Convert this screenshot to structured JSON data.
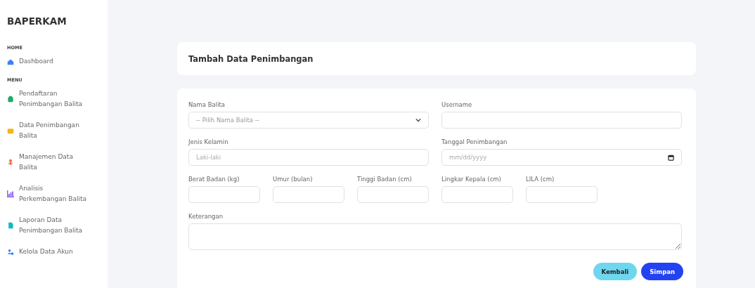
{
  "sidebar": {
    "brand": "BAPERKAM",
    "sections": [
      {
        "heading": "HOME",
        "items": [
          {
            "label": "Dashboard",
            "color": "#3b82f6"
          }
        ]
      },
      {
        "heading": "MENU",
        "items": [
          {
            "label": "Pendaftaran Penimbangan Balita",
            "color": "#22a861"
          },
          {
            "label": "Data Penimbangan Balita",
            "color": "#f2b619"
          },
          {
            "label": "Manajemen Data Balita",
            "color": "#f0734f"
          },
          {
            "label": "Analisis Perkembangan Balita",
            "color": "#8b5cf6"
          },
          {
            "label": "Laporan Data Penimbangan Balita",
            "color": "#14b8c6"
          },
          {
            "label": "Kelola Data Akun",
            "color": "#3b82f6"
          }
        ]
      }
    ]
  },
  "header": {
    "title": "Tambah Data Penimbangan"
  },
  "form": {
    "rows": [
      {
        "fields": [
          {
            "label": "Nama Balita",
            "kind": "select",
            "value": "-- Pilih Nama Balita --"
          },
          {
            "label": "Username",
            "kind": "text"
          }
        ]
      },
      {
        "fields": [
          {
            "label": "Jenis Kelamin",
            "kind": "text",
            "placeholder": "Laki-laki"
          },
          {
            "label": "Tanggal Penimbangan",
            "kind": "date",
            "placeholder": "mm/dd/yyyy"
          }
        ]
      },
      {
        "fields": [
          {
            "label": "Berat Badan (kg)",
            "kind": "text"
          },
          {
            "label": "Umur (bulan)",
            "kind": "text"
          },
          {
            "label": "Tinggi Badan (cm)",
            "kind": "text"
          },
          {
            "label": "Lingkar Kepala (cm)",
            "kind": "text"
          },
          {
            "label": "LILA (cm)",
            "kind": "text"
          }
        ]
      },
      {
        "fields": [
          {
            "label": "Keterangan",
            "kind": "textarea"
          }
        ]
      }
    ],
    "buttons": [
      {
        "label": "Kembali",
        "kind": "secondary"
      },
      {
        "label": "Simpan",
        "kind": "primary"
      }
    ]
  }
}
